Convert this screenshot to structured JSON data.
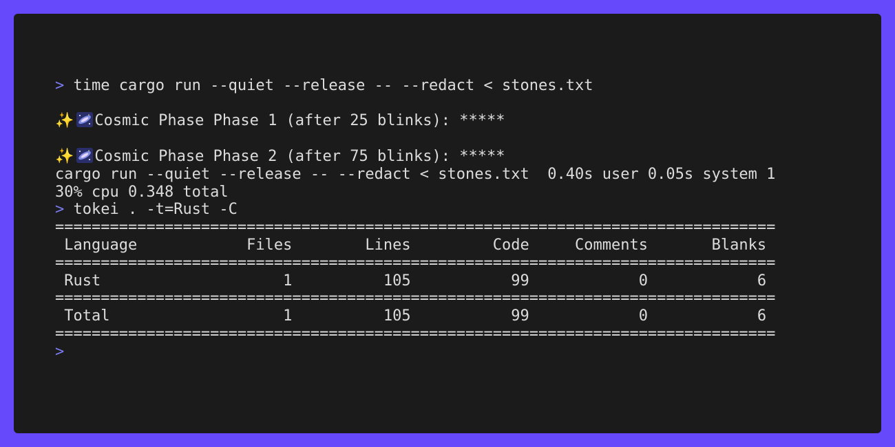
{
  "colors": {
    "background": "#6549fb",
    "terminal_bg": "#1b1b1b",
    "text": "#dcdcdc",
    "prompt": "#7b7bf0"
  },
  "terminal": {
    "prompt_symbol": ">",
    "cmd1": "time cargo run --quiet --release -- --redact < stones.txt",
    "output_icons": [
      "sparkles-icon",
      "milky-way-icon"
    ],
    "phase1": "Cosmic Phase Phase 1 (after 25 blinks): *****",
    "phase2": "Cosmic Phase Phase 2 (after 75 blinks): *****",
    "time_line1": "cargo run --quiet --release -- --redact < stones.txt  0.40s user 0.05s system 1",
    "time_line2": "30% cpu 0.348 total",
    "cmd2": "tokei . -t=Rust -C",
    "tokei": {
      "separator": "===============================================================================",
      "header": " Language            Files        Lines         Code     Comments       Blanks",
      "rows": [
        " Rust                    1          105           99            0            6",
        " Total                   1          105           99            0            6"
      ]
    }
  }
}
